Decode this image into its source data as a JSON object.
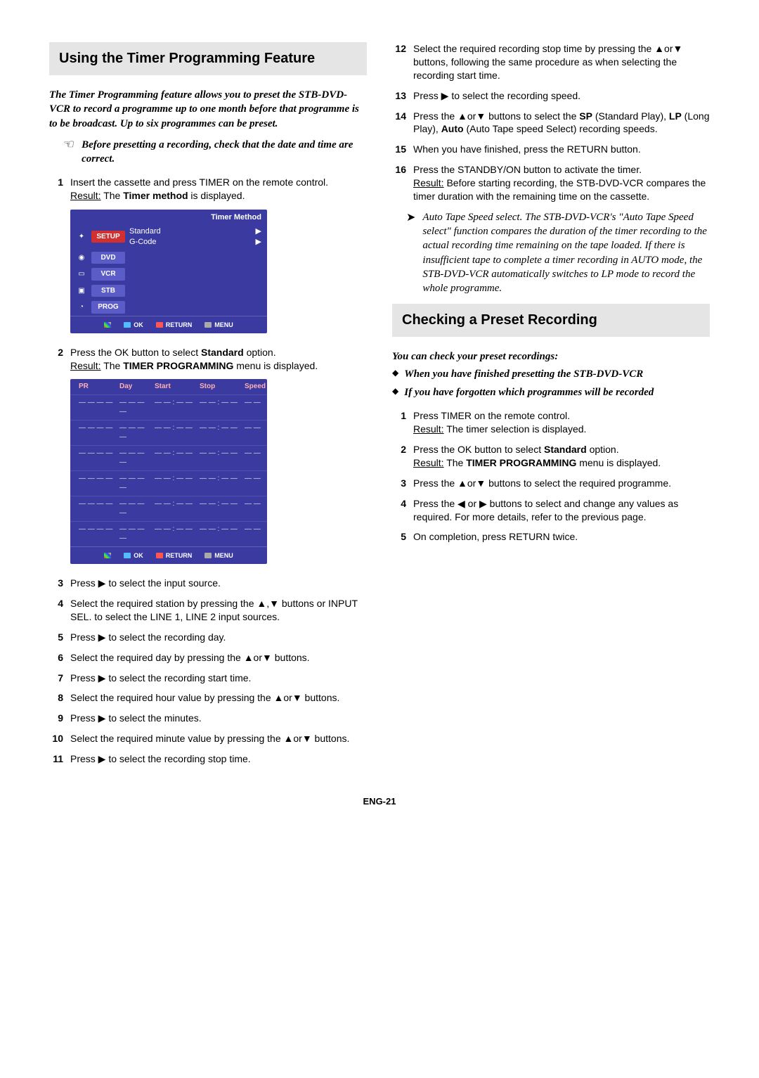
{
  "heading1": "Using the Timer Programming Feature",
  "intro": "The Timer Programming feature allows you to preset the STB-DVD-VCR to record a programme up to one month before that programme is to be broadcast. Up to six programmes can be preset.",
  "hand_note": "Before presetting a recording, check that the date and time are correct.",
  "left_steps": {
    "s1_a": "Insert the cassette and press TIMER on the remote control.",
    "s1_result_label": "Result:",
    "s1_result_a": "  The ",
    "s1_result_bold": "Timer method",
    "s1_result_b": " is displayed.",
    "s2_a": "Press the OK button to select ",
    "s2_bold": "Standard",
    "s2_b": " option.",
    "s2_result_label": "Result:",
    "s2_result_a": "  The ",
    "s2_result_bold": "TIMER PROGRAMMING",
    "s2_result_b": " menu is displayed.",
    "s3": "Press ▶ to select the input source.",
    "s4": "Select the required station by pressing the ▲,▼ buttons or INPUT SEL. to select the LINE 1, LINE 2 input sources.",
    "s5": "Press ▶ to select the recording day.",
    "s6": "Select the required day by pressing the ▲or▼ buttons.",
    "s7": "Press ▶ to select the recording start time.",
    "s8": "Select the required hour value by pressing the ▲or▼ buttons.",
    "s9": "Press ▶ to select the minutes.",
    "s10": "Select the required minute value by pressing the ▲or▼ buttons.",
    "s11": "Press ▶ to select the recording stop time."
  },
  "osd1": {
    "title": "Timer Method",
    "menu": [
      "SETUP",
      "DVD",
      "VCR",
      "STB",
      "PROG"
    ],
    "options": [
      "Standard",
      "G-Code"
    ],
    "footer": [
      "",
      "OK",
      "RETURN",
      "MENU"
    ]
  },
  "osd2": {
    "headers": [
      "PR",
      "Day",
      "Start",
      "Stop",
      "Speed"
    ],
    "row": [
      "— — — —",
      "— —   — —",
      "— — : — —",
      "— — : — —",
      "— —"
    ],
    "footer": [
      "",
      "OK",
      "RETURN",
      "MENU"
    ]
  },
  "right_steps": {
    "s12": "Select the required recording stop time by pressing the ▲or▼ buttons, following the same procedure as when selecting the recording start time.",
    "s13": "Press  ▶ to select the recording speed.",
    "s14_a": "Press the ▲or▼ buttons to select the ",
    "s14_b1": "SP",
    "s14_c": " (Standard Play), ",
    "s14_b2": "LP",
    "s14_d": " (Long Play), ",
    "s14_b3": "Auto",
    "s14_e": " (Auto Tape speed Select) recording speeds.",
    "s15": "When you have finished, press the RETURN button.",
    "s16_a": "Press the STANDBY/ON button to activate the timer.",
    "s16_result_label": "Result:",
    "s16_result": "  Before starting recording, the STB-DVD-VCR compares the timer duration with the remaining time on the cassette."
  },
  "auto_note": "Auto Tape Speed select. The STB-DVD-VCR's \"Auto Tape Speed select\" function compares the duration of the timer recording to the actual recording time remaining on the tape loaded. If there is insufficient tape to complete a timer recording in AUTO mode, the STB-DVD-VCR automatically switches to LP mode to record the whole programme.",
  "heading2": "Checking a Preset Recording",
  "check_intro": "You can check your preset recordings:",
  "check_bullets": [
    "When you have finished presetting the STB-DVD-VCR",
    "If you have forgotten which programmes will be recorded"
  ],
  "check_steps": {
    "s1_a": "Press TIMER on the remote control.",
    "s1_result_label": "Result:",
    "s1_result": "  The timer selection is displayed.",
    "s2_a": "Press the OK button to select ",
    "s2_bold": "Standard",
    "s2_b": " option.",
    "s2_result_label": "Result:",
    "s2_result_a": "  The ",
    "s2_result_bold": "TIMER PROGRAMMING",
    "s2_result_b": " menu is displayed.",
    "s3": "Press the ▲or▼ buttons to select the required programme.",
    "s4": "Press the ◀ or ▶ buttons to select and change any values as required. For more details, refer to the previous page.",
    "s5": "On completion, press RETURN twice."
  },
  "page_num": "ENG-21"
}
